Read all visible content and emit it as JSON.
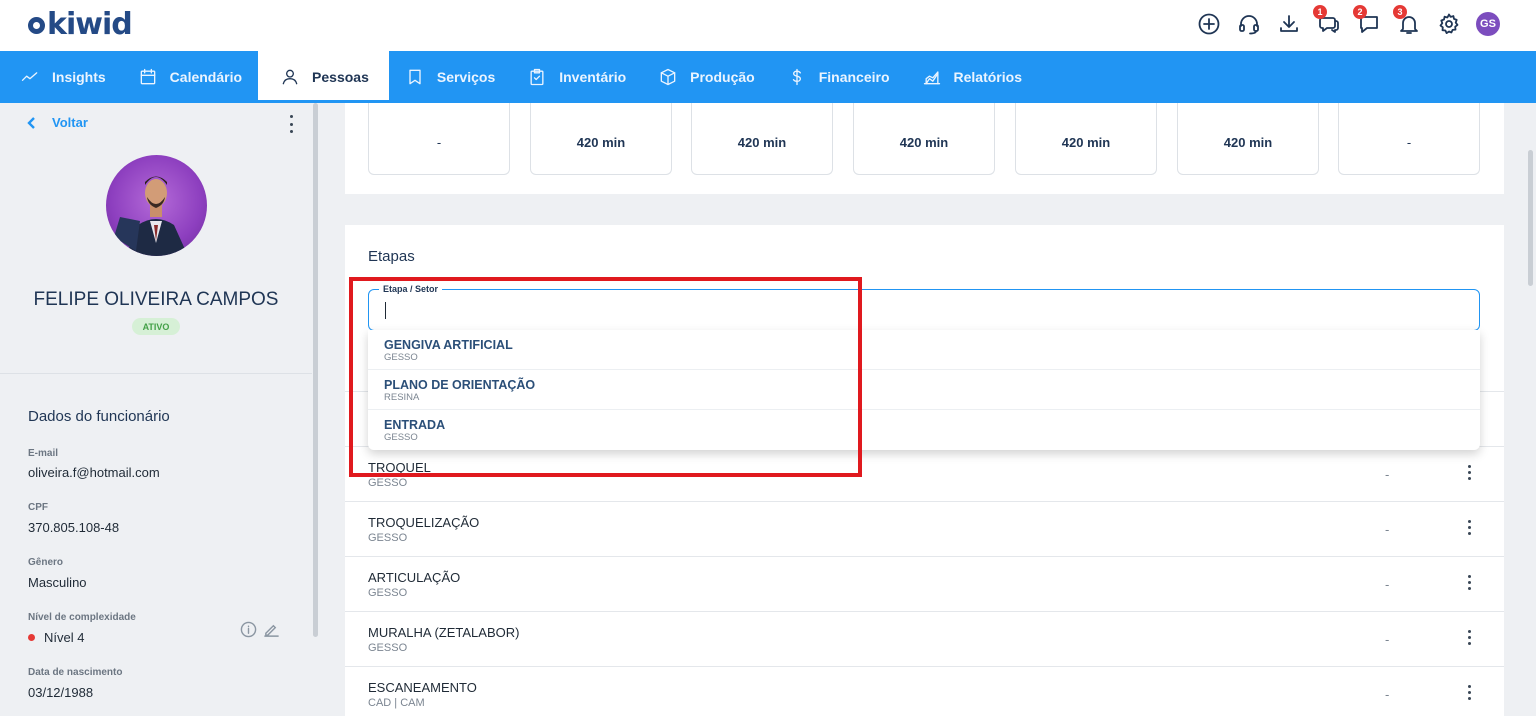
{
  "brand": {
    "logo_text": "KIWID"
  },
  "topbar": {
    "badges": {
      "chat": "1",
      "messages": "2",
      "notifications": "3"
    },
    "user_initials": "GS"
  },
  "nav": {
    "items": [
      {
        "label": "Insights",
        "icon": "trend-icon"
      },
      {
        "label": "Calendário",
        "icon": "calendar-icon"
      },
      {
        "label": "Pessoas",
        "icon": "person-icon",
        "active": true
      },
      {
        "label": "Serviços",
        "icon": "bookmark-icon"
      },
      {
        "label": "Inventário",
        "icon": "clipboard-icon"
      },
      {
        "label": "Produção",
        "icon": "box-icon"
      },
      {
        "label": "Financeiro",
        "icon": "dollar-icon"
      },
      {
        "label": "Relatórios",
        "icon": "chart-icon"
      }
    ]
  },
  "profile": {
    "back_label": "Voltar",
    "name": "FELIPE OLIVEIRA CAMPOS",
    "status": "ATIVO",
    "section_title": "Dados do funcionário",
    "fields": {
      "email_label": "E-mail",
      "email": "oliveira.f@hotmail.com",
      "cpf_label": "CPF",
      "cpf": "370.805.108-48",
      "gender_label": "Gênero",
      "gender": "Masculino",
      "level_label": "Nível de complexidade",
      "level": "Nível 4",
      "birth_label": "Data de nascimento",
      "birth": "03/12/1988"
    }
  },
  "schedule": {
    "days": [
      "-",
      "420 min",
      "420 min",
      "420 min",
      "420 min",
      "420 min",
      "-"
    ]
  },
  "etapas": {
    "title": "Etapas",
    "input_label": "Etapa / Setor",
    "input_value": "",
    "dropdown": [
      {
        "title": "GENGIVA ARTIFICIAL",
        "sub": "GESSO"
      },
      {
        "title": "PLANO DE ORIENTAÇÃO",
        "sub": "RESINA"
      },
      {
        "title": "ENTRADA",
        "sub": "GESSO"
      }
    ],
    "rows": [
      {
        "title": "TROQUEL",
        "sub": "GESSO",
        "value": "-"
      },
      {
        "title": "TROQUELIZAÇÃO",
        "sub": "GESSO",
        "value": "-"
      },
      {
        "title": "ARTICULAÇÃO",
        "sub": "GESSO",
        "value": "-"
      },
      {
        "title": "MURALHA (ZETALABOR)",
        "sub": "GESSO",
        "value": "-"
      },
      {
        "title": "ESCANEAMENTO",
        "sub": "CAD | CAM",
        "value": "-"
      }
    ]
  },
  "colors": {
    "primary": "#2195f3",
    "highlight": "#e0191e",
    "status_green": "#43a047",
    "level_red": "#e53935"
  }
}
